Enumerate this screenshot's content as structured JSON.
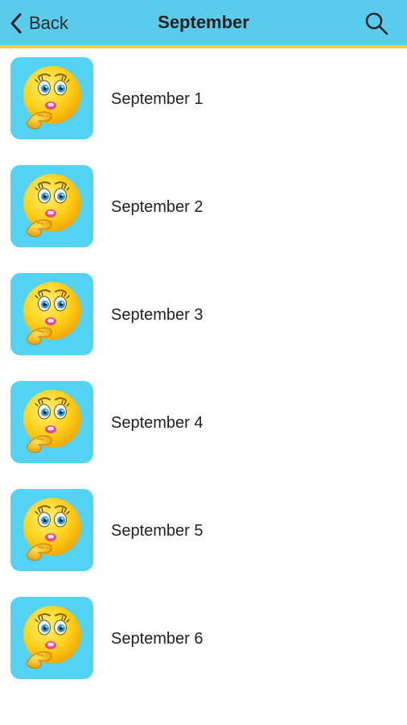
{
  "navbar": {
    "back_label": "Back",
    "title": "September",
    "back_icon": "chevron-left-icon",
    "search_icon": "search-icon"
  },
  "colors": {
    "navbar_bg": "#5acbea",
    "navbar_border": "#f6cf2a",
    "thumb_bg": "#54d3f5"
  },
  "items": [
    {
      "label": "September 1",
      "icon": "thinking-emoji-icon"
    },
    {
      "label": "September 2",
      "icon": "thinking-emoji-icon"
    },
    {
      "label": "September 3",
      "icon": "thinking-emoji-icon"
    },
    {
      "label": "September 4",
      "icon": "thinking-emoji-icon"
    },
    {
      "label": "September 5",
      "icon": "thinking-emoji-icon"
    },
    {
      "label": "September 6",
      "icon": "thinking-emoji-icon"
    }
  ]
}
